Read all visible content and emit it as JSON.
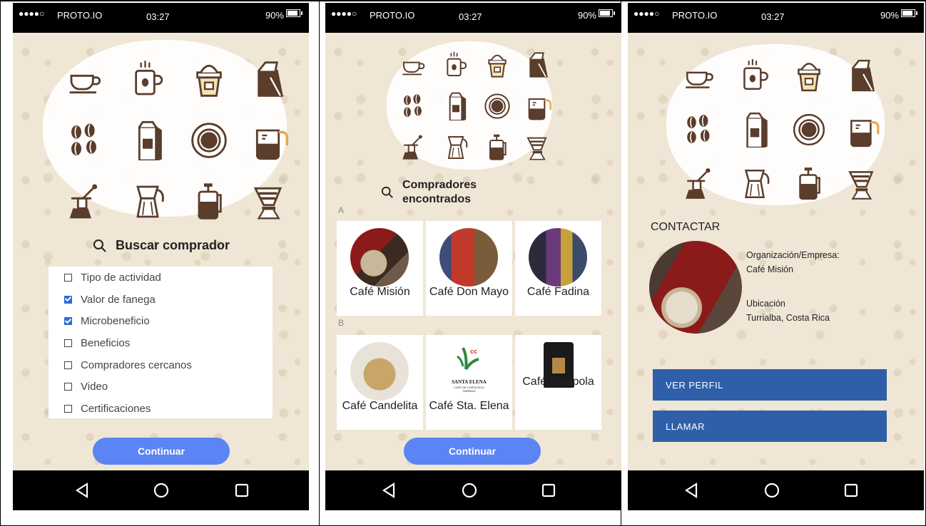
{
  "status": {
    "dots": "●●●●○",
    "carrier": "PROTO.IO",
    "time": "03:27",
    "battery": "90%",
    "battery_level": 0.9
  },
  "screen1": {
    "search_label": "Buscar comprador",
    "options": [
      {
        "label": "Tipo de actividad",
        "checked": false
      },
      {
        "label": "Valor de fanega",
        "checked": true
      },
      {
        "label": "Microbeneficio",
        "checked": true
      },
      {
        "label": "Beneficios",
        "checked": false
      },
      {
        "label": "Compradores cercanos",
        "checked": false
      },
      {
        "label": "Video",
        "checked": false
      },
      {
        "label": "Certificaciones",
        "checked": false
      }
    ],
    "continue_label": "Continuar"
  },
  "screen2": {
    "search_label": "Compradores encontrados",
    "section_a": "A",
    "section_b": "B",
    "cards": [
      {
        "name": "Café Misión"
      },
      {
        "name": "Café Don Mayo"
      },
      {
        "name": "Café Fadina"
      },
      {
        "name": "Café Candelita"
      },
      {
        "name": "Café Sta. Elena"
      },
      {
        "name": "Café Amapola"
      }
    ],
    "logo_text_1": "SANTA ELENA",
    "logo_text_2": "CAFÉ DE COSTA RICA",
    "logo_text_3": "TARRAZU",
    "continue_label": "Continuar"
  },
  "screen3": {
    "contact_title": "CONTACTAR",
    "org_label": "Organización/Empresa:",
    "org_value": "Café Misión",
    "location_label": "Ubicación",
    "location_value": "Turrialba, Costa Rica",
    "view_profile_label": "VER PERFIL",
    "call_label": "LLAMAR"
  },
  "icons": [
    "cup-icon",
    "mug-icon",
    "iced-coffee-icon",
    "coffee-bag-icon",
    "coffee-beans-icon",
    "coffee-package-icon",
    "coffee-cup-topview-icon",
    "coffee-pot-icon",
    "grinder-icon",
    "moka-pot-icon",
    "french-press-icon",
    "pour-over-icon"
  ],
  "colors": {
    "accent": "#5b84f4",
    "button_blue": "#2f5fa8",
    "checkbox_blue": "#2e6bd8",
    "background": "#efe6d6"
  }
}
